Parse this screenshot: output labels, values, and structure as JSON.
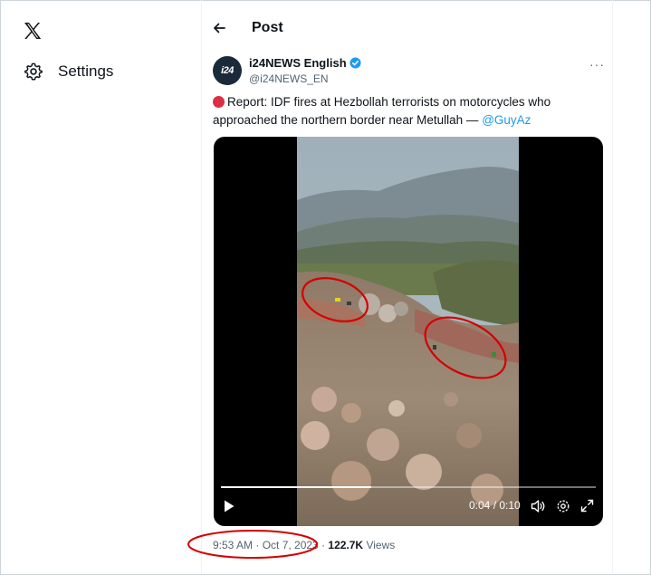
{
  "sidebar": {
    "logo_icon": "x-logo-icon",
    "settings_label": "Settings"
  },
  "header": {
    "title": "Post"
  },
  "post": {
    "author_name": "i24NEWS English",
    "author_handle": "@i24NEWS_EN",
    "avatar_text": "i24",
    "text_main": "Report: IDF fires at Hezbollah terrorists on motorcycles who approached the northern border near Metullah — ",
    "mention": "@GuyAz",
    "more_label": "···",
    "video": {
      "time_display": "0:04 / 0:10",
      "progress": 0.4
    },
    "time": "9:53 AM · Oct 7, 2023",
    "separator": " · ",
    "views_count": "122.7K",
    "views_label": "Views"
  },
  "colors": {
    "accent": "#1d9bf0",
    "annotation_red": "#d40000",
    "verified": "#1d9bf0"
  }
}
